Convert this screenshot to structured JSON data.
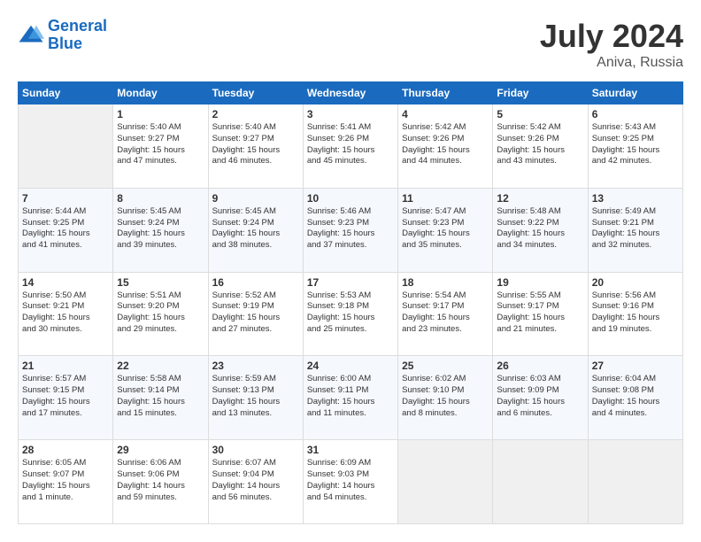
{
  "header": {
    "logo_line1": "General",
    "logo_line2": "Blue",
    "title": "July 2024",
    "subtitle": "Aniva, Russia"
  },
  "weekdays": [
    "Sunday",
    "Monday",
    "Tuesday",
    "Wednesday",
    "Thursday",
    "Friday",
    "Saturday"
  ],
  "weeks": [
    [
      {
        "day": "",
        "info": ""
      },
      {
        "day": "1",
        "info": "Sunrise: 5:40 AM\nSunset: 9:27 PM\nDaylight: 15 hours\nand 47 minutes."
      },
      {
        "day": "2",
        "info": "Sunrise: 5:40 AM\nSunset: 9:27 PM\nDaylight: 15 hours\nand 46 minutes."
      },
      {
        "day": "3",
        "info": "Sunrise: 5:41 AM\nSunset: 9:26 PM\nDaylight: 15 hours\nand 45 minutes."
      },
      {
        "day": "4",
        "info": "Sunrise: 5:42 AM\nSunset: 9:26 PM\nDaylight: 15 hours\nand 44 minutes."
      },
      {
        "day": "5",
        "info": "Sunrise: 5:42 AM\nSunset: 9:26 PM\nDaylight: 15 hours\nand 43 minutes."
      },
      {
        "day": "6",
        "info": "Sunrise: 5:43 AM\nSunset: 9:25 PM\nDaylight: 15 hours\nand 42 minutes."
      }
    ],
    [
      {
        "day": "7",
        "info": "Sunrise: 5:44 AM\nSunset: 9:25 PM\nDaylight: 15 hours\nand 41 minutes."
      },
      {
        "day": "8",
        "info": "Sunrise: 5:45 AM\nSunset: 9:24 PM\nDaylight: 15 hours\nand 39 minutes."
      },
      {
        "day": "9",
        "info": "Sunrise: 5:45 AM\nSunset: 9:24 PM\nDaylight: 15 hours\nand 38 minutes."
      },
      {
        "day": "10",
        "info": "Sunrise: 5:46 AM\nSunset: 9:23 PM\nDaylight: 15 hours\nand 37 minutes."
      },
      {
        "day": "11",
        "info": "Sunrise: 5:47 AM\nSunset: 9:23 PM\nDaylight: 15 hours\nand 35 minutes."
      },
      {
        "day": "12",
        "info": "Sunrise: 5:48 AM\nSunset: 9:22 PM\nDaylight: 15 hours\nand 34 minutes."
      },
      {
        "day": "13",
        "info": "Sunrise: 5:49 AM\nSunset: 9:21 PM\nDaylight: 15 hours\nand 32 minutes."
      }
    ],
    [
      {
        "day": "14",
        "info": "Sunrise: 5:50 AM\nSunset: 9:21 PM\nDaylight: 15 hours\nand 30 minutes."
      },
      {
        "day": "15",
        "info": "Sunrise: 5:51 AM\nSunset: 9:20 PM\nDaylight: 15 hours\nand 29 minutes."
      },
      {
        "day": "16",
        "info": "Sunrise: 5:52 AM\nSunset: 9:19 PM\nDaylight: 15 hours\nand 27 minutes."
      },
      {
        "day": "17",
        "info": "Sunrise: 5:53 AM\nSunset: 9:18 PM\nDaylight: 15 hours\nand 25 minutes."
      },
      {
        "day": "18",
        "info": "Sunrise: 5:54 AM\nSunset: 9:17 PM\nDaylight: 15 hours\nand 23 minutes."
      },
      {
        "day": "19",
        "info": "Sunrise: 5:55 AM\nSunset: 9:17 PM\nDaylight: 15 hours\nand 21 minutes."
      },
      {
        "day": "20",
        "info": "Sunrise: 5:56 AM\nSunset: 9:16 PM\nDaylight: 15 hours\nand 19 minutes."
      }
    ],
    [
      {
        "day": "21",
        "info": "Sunrise: 5:57 AM\nSunset: 9:15 PM\nDaylight: 15 hours\nand 17 minutes."
      },
      {
        "day": "22",
        "info": "Sunrise: 5:58 AM\nSunset: 9:14 PM\nDaylight: 15 hours\nand 15 minutes."
      },
      {
        "day": "23",
        "info": "Sunrise: 5:59 AM\nSunset: 9:13 PM\nDaylight: 15 hours\nand 13 minutes."
      },
      {
        "day": "24",
        "info": "Sunrise: 6:00 AM\nSunset: 9:11 PM\nDaylight: 15 hours\nand 11 minutes."
      },
      {
        "day": "25",
        "info": "Sunrise: 6:02 AM\nSunset: 9:10 PM\nDaylight: 15 hours\nand 8 minutes."
      },
      {
        "day": "26",
        "info": "Sunrise: 6:03 AM\nSunset: 9:09 PM\nDaylight: 15 hours\nand 6 minutes."
      },
      {
        "day": "27",
        "info": "Sunrise: 6:04 AM\nSunset: 9:08 PM\nDaylight: 15 hours\nand 4 minutes."
      }
    ],
    [
      {
        "day": "28",
        "info": "Sunrise: 6:05 AM\nSunset: 9:07 PM\nDaylight: 15 hours\nand 1 minute."
      },
      {
        "day": "29",
        "info": "Sunrise: 6:06 AM\nSunset: 9:06 PM\nDaylight: 14 hours\nand 59 minutes."
      },
      {
        "day": "30",
        "info": "Sunrise: 6:07 AM\nSunset: 9:04 PM\nDaylight: 14 hours\nand 56 minutes."
      },
      {
        "day": "31",
        "info": "Sunrise: 6:09 AM\nSunset: 9:03 PM\nDaylight: 14 hours\nand 54 minutes."
      },
      {
        "day": "",
        "info": ""
      },
      {
        "day": "",
        "info": ""
      },
      {
        "day": "",
        "info": ""
      }
    ]
  ]
}
